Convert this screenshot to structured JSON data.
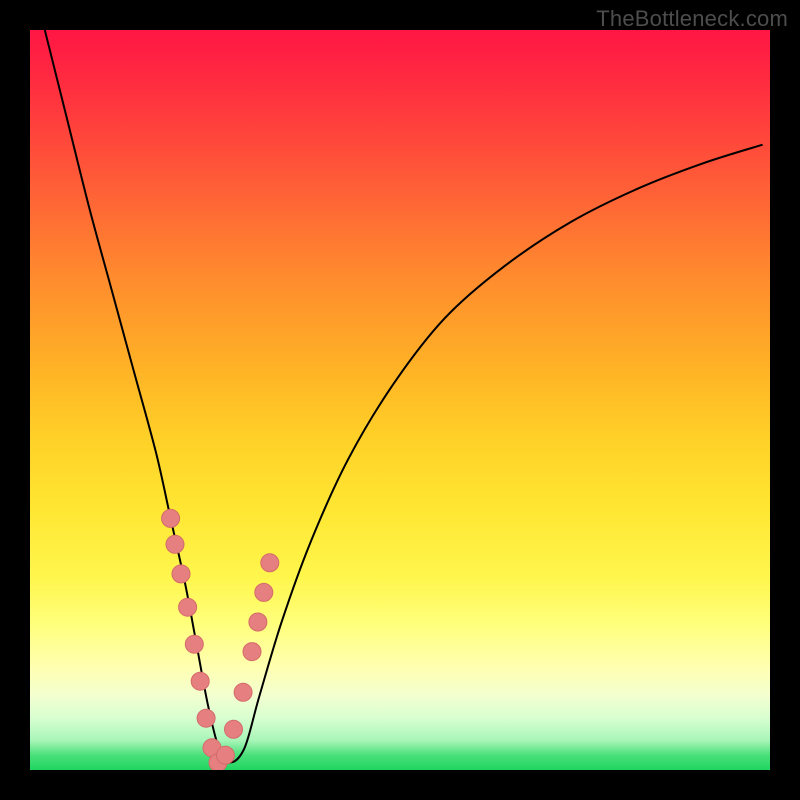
{
  "watermark": "TheBottleneck.com",
  "colors": {
    "curve": "#000000",
    "marker_fill": "#e68080",
    "marker_stroke": "#d46a6a",
    "background_top": "#ff1644",
    "background_bottom": "#1fd561"
  },
  "chart_data": {
    "type": "line",
    "title": "",
    "xlabel": "",
    "ylabel": "",
    "xlim": [
      0,
      100
    ],
    "ylim": [
      0,
      100
    ],
    "grid": false,
    "legend": false,
    "note": "V-shaped bottleneck curve. y represents mismatch percentage (high=red=bad, low=green=good). x represents a component performance scale. Minimum (best match) occurs near x≈25. No numeric axes are drawn; values are read from curve geometry relative to the 740×740 plot area mapped to 0–100.",
    "series": [
      {
        "name": "bottleneck-curve",
        "x": [
          2,
          5,
          8,
          11,
          14,
          17,
          19,
          21,
          22.5,
          24,
          25.5,
          27,
          29,
          31,
          34,
          38,
          43,
          49,
          56,
          64,
          73,
          82,
          91,
          99
        ],
        "y": [
          100,
          88,
          76,
          65,
          54,
          43,
          34,
          25,
          17,
          9,
          3,
          1,
          3,
          10,
          20,
          31,
          42,
          52,
          61,
          68,
          74,
          78.5,
          82,
          84.5
        ]
      }
    ],
    "markers": {
      "name": "highlighted-points",
      "note": "Pink/coral dots clustered near the valley of the curve, on both descending and ascending arms.",
      "x": [
        19.0,
        19.6,
        20.4,
        21.3,
        22.2,
        23.0,
        23.8,
        24.6,
        25.4,
        26.4,
        27.5,
        28.8,
        30.0,
        30.8,
        31.6,
        32.4
      ],
      "y": [
        34.0,
        30.5,
        26.5,
        22.0,
        17.0,
        12.0,
        7.0,
        3.0,
        1.0,
        2.0,
        5.5,
        10.5,
        16.0,
        20.0,
        24.0,
        28.0
      ]
    }
  }
}
